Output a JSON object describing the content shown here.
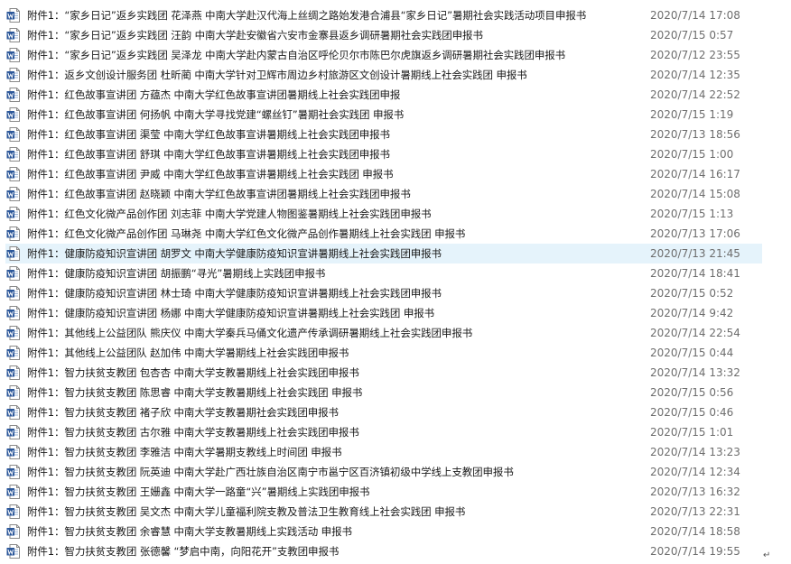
{
  "files": [
    {
      "name": "附件1：“家乡日记”返乡实践团 花泽燕 中南大学赴汉代海上丝绸之路始发港合浦县“家乡日记”暑期社会实践活动项目申报书",
      "date": "2020/7/14 17:08",
      "icon": "word-doc-icon"
    },
    {
      "name": "附件1：“家乡日记”返乡实践团 汪韵 中南大学赴安徽省六安市金寨县返乡调研暑期社会实践团申报书",
      "date": "2020/7/15 0:57",
      "icon": "word-doc-icon"
    },
    {
      "name": "附件1：“家乡日记”返乡实践团 吴泽龙 中南大学赴内蒙古自治区呼伦贝尔市陈巴尔虎旗返乡调研暑期社会实践团申报书",
      "date": "2020/7/12 23:55",
      "icon": "word-doc-icon"
    },
    {
      "name": "附件1：返乡文创设计服务团 杜昕蔺 中南大学针对卫辉市周边乡村旅游区文创设计暑期线上社会实践团 申报书",
      "date": "2020/7/14 12:35",
      "icon": "word-doc-icon"
    },
    {
      "name": "附件1：红色故事宣讲团 方蕴杰 中南大学红色故事宣讲团暑期线上社会实践团申报",
      "date": "2020/7/14 22:52",
      "icon": "word-doc-icon"
    },
    {
      "name": "附件1：红色故事宣讲团 何扬帆 中南大学寻找党建“螺丝钉”暑期社会实践团 申报书",
      "date": "2020/7/15 1:19",
      "icon": "word-doc-icon"
    },
    {
      "name": "附件1：红色故事宣讲团 渠莹 中南大学红色故事宣讲暑期线上社会实践团申报书",
      "date": "2020/7/13 18:56",
      "icon": "word-doc-icon"
    },
    {
      "name": "附件1：红色故事宣讲团 舒琪 中南大学红色故事宣讲暑期线上社会实践团申报书",
      "date": "2020/7/15 1:00",
      "icon": "word-doc-icon"
    },
    {
      "name": "附件1：红色故事宣讲团 尹威 中南大学红色故事宣讲暑期线上社会实践团 申报书",
      "date": "2020/7/14 16:17",
      "icon": "word-doc-icon"
    },
    {
      "name": "附件1：红色故事宣讲团 赵晓颖 中南大学红色故事宣讲团暑期线上社会实践团申报书",
      "date": "2020/7/14 15:08",
      "icon": "word-doc-icon"
    },
    {
      "name": "附件1：红色文化微产品创作团 刘志菲 中南大学党建人物图鉴暑期线上社会实践团申报书",
      "date": "2020/7/15 1:13",
      "icon": "word-doc-icon"
    },
    {
      "name": "附件1：红色文化微产品创作团 马琳尧 中南大学红色文化微产品创作暑期线上社会实践团 申报书",
      "date": "2020/7/13 17:06",
      "icon": "word-doc-icon"
    },
    {
      "name": "附件1：健康防疫知识宣讲团 胡罗文 中南大学健康防疫知识宣讲暑期线上社会实践团申报书",
      "date": "2020/7/13 21:45",
      "icon": "word-doc-icon",
      "selected": true
    },
    {
      "name": "附件1：健康防疫知识宣讲团 胡振鹏“寻光”暑期线上实践团申报书",
      "date": "2020/7/14 18:41",
      "icon": "word-doc-icon"
    },
    {
      "name": "附件1：健康防疫知识宣讲团 林士琦 中南大学健康防疫知识宣讲暑期线上社会实践团申报书",
      "date": "2020/7/15 0:52",
      "icon": "word-doc-icon"
    },
    {
      "name": "附件1：健康防疫知识宣讲团 杨娜 中南大学健康防疫知识宣讲暑期线上社会实践团 申报书",
      "date": "2020/7/14 9:42",
      "icon": "word-doc-icon"
    },
    {
      "name": "附件1：其他线上公益团队 熊庆仪 中南大学秦兵马俑文化遗产传承调研暑期线上社会实践团申报书",
      "date": "2020/7/14 22:54",
      "icon": "word-doc-icon"
    },
    {
      "name": "附件1：其他线上公益团队 赵加伟 中南大学暑期线上社会实践团申报书",
      "date": "2020/7/15 0:44",
      "icon": "word-doc-icon"
    },
    {
      "name": "附件1：智力扶贫支教团 包杏杏 中南大学支教暑期线上社会实践团申报书",
      "date": "2020/7/14 13:32",
      "icon": "word-doc-icon"
    },
    {
      "name": "附件1：智力扶贫支教团 陈思睿 中南大学支教暑期线上社会实践团 申报书",
      "date": "2020/7/15 0:56",
      "icon": "word-doc-icon"
    },
    {
      "name": "附件1：智力扶贫支教团 褚子欣 中南大学支教暑期社会实践团申报书",
      "date": "2020/7/15 0:46",
      "icon": "word-doc-icon"
    },
    {
      "name": "附件1：智力扶贫支教团 古尔雅 中南大学支教暑期线上社会实践团申报书",
      "date": "2020/7/15 1:01",
      "icon": "word-doc-icon"
    },
    {
      "name": "附件1：智力扶贫支教团 李雅洁 中南大学暑期支教线上时间团 申报书",
      "date": "2020/7/14 13:23",
      "icon": "word-doc-icon"
    },
    {
      "name": "附件1：智力扶贫支教团 阮英迪 中南大学赴广西壮族自治区南宁市邕宁区百济镇初级中学线上支教团申报书",
      "date": "2020/7/14 12:34",
      "icon": "word-doc-icon"
    },
    {
      "name": "附件1：智力扶贫支教团 王姗鑫 中南大学一路童“兴”暑期线上实践团申报书",
      "date": "2020/7/13 16:32",
      "icon": "word-doc-icon"
    },
    {
      "name": "附件1：智力扶贫支教团 吴文杰 中南大学儿童福利院支教及普法卫生教育线上社会实践团 申报书",
      "date": "2020/7/13 22:31",
      "icon": "word-doc-icon"
    },
    {
      "name": "附件1：智力扶贫支教团 余睿慧 中南大学支教暑期线上实践活动 申报书",
      "date": "2020/7/14 18:58",
      "icon": "word-doc-icon"
    },
    {
      "name": "附件1：智力扶贫支教团 张德馨 “梦启中南，向阳花开”支教团申报书",
      "date": "2020/7/14 19:55",
      "icon": "word-doc-icon"
    }
  ],
  "paragraph_mark": "↵",
  "colors": {
    "selection": "#e5f3fb",
    "word_blue": "#2b579a",
    "date_gray": "#6d6d6d"
  }
}
